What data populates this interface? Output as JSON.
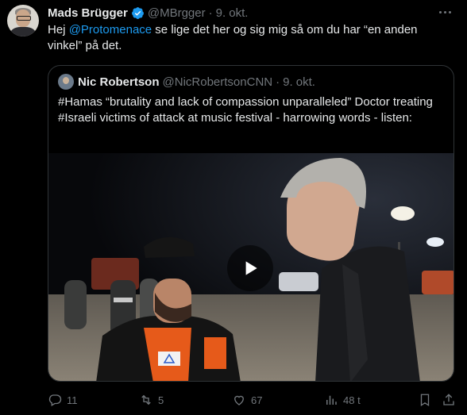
{
  "tweet": {
    "author_name": "Mads Brügger",
    "handle": "@MBrgger",
    "separator": "·",
    "date": "9. okt.",
    "text_before": "Hej ",
    "mention": "@Protomenace",
    "text_after": " se lige det her og sig mig så om du har “en anden vinkel” på det."
  },
  "quote": {
    "author_name": "Nic Robertson",
    "handle": "@NicRobertsonCNN",
    "separator": "·",
    "date": "9. okt.",
    "text": "#Hamas “brutality and lack of compassion unparalleled” Doctor treating #Israeli victims of attack at music festival - harrowing words - listen:"
  },
  "actions": {
    "replies": "11",
    "reposts": "5",
    "likes": "67",
    "views": "48 t"
  },
  "colors": {
    "background": "#000000",
    "text": "#e7e9ea",
    "muted": "#71767b",
    "accent": "#1d9bf0",
    "border": "#2f3336"
  },
  "icons": [
    "verified-badge-icon",
    "more-icon",
    "play-icon",
    "reply-icon",
    "repost-icon",
    "like-icon",
    "views-icon",
    "bookmark-icon",
    "share-icon"
  ]
}
